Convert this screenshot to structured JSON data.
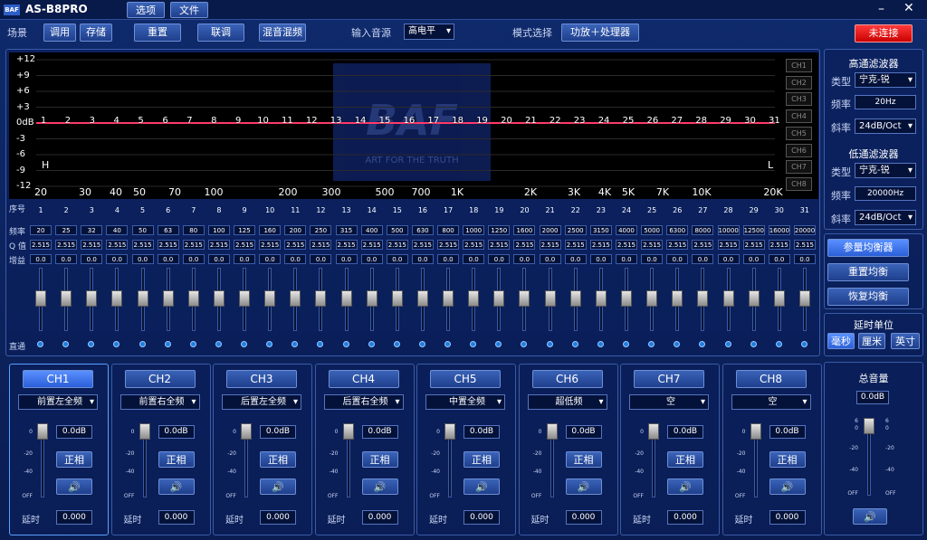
{
  "title": "AS-B8PRO",
  "menu": [
    "选项",
    "文件"
  ],
  "toolbar": {
    "scene_label": "场景",
    "call": "调用",
    "store": "存储",
    "reset": "重置",
    "link": "联调",
    "mix": "混音混频",
    "input_label": "输入音源",
    "input_value": "高电平",
    "mode_label": "模式选择",
    "mode_value": "功放＋处理器",
    "status": "未连接"
  },
  "graph": {
    "db_labels": [
      "+12",
      "+9",
      "+6",
      "+3",
      "0dB",
      "-3",
      "-6",
      "-9",
      "-12"
    ],
    "h_marker": "H",
    "l_marker": "L",
    "freq_labels": [
      "20",
      "30",
      "40",
      "50",
      "70",
      "100",
      "200",
      "300",
      "500",
      "700",
      "1K",
      "2K",
      "3K",
      "4K",
      "5K",
      "7K",
      "10K",
      "20K"
    ],
    "watermark": "BAF",
    "watermark_sub": "ART FOR THE TRUTH",
    "ch_buttons": [
      "CH1",
      "CH2",
      "CH3",
      "CH4",
      "CH5",
      "CH6",
      "CH7",
      "CH8"
    ]
  },
  "eq": {
    "row_labels": [
      "序号",
      "频率",
      "Q 值",
      "增益"
    ],
    "bypass_label": "直通",
    "freqs": [
      "20",
      "25",
      "32",
      "40",
      "50",
      "63",
      "80",
      "100",
      "125",
      "160",
      "200",
      "250",
      "315",
      "400",
      "500",
      "630",
      "800",
      "1000",
      "1250",
      "1600",
      "2000",
      "2500",
      "3150",
      "4000",
      "5000",
      "6300",
      "8000",
      "10000",
      "12500",
      "16000",
      "20000"
    ],
    "q": "2.515",
    "gain": "0.0"
  },
  "hpf": {
    "title": "高通滤波器",
    "type_label": "类型",
    "type": "宁克-锐",
    "freq_label": "频率",
    "freq": "20Hz",
    "slope_label": "斜率",
    "slope": "24dB/Oct"
  },
  "lpf": {
    "title": "低通滤波器",
    "type_label": "类型",
    "type": "宁克-锐",
    "freq_label": "频率",
    "freq": "20000Hz",
    "slope_label": "斜率",
    "slope": "24dB/Oct"
  },
  "side": {
    "peq": "参量均衡器",
    "reset_eq": "重置均衡",
    "restore_eq": "恢复均衡",
    "delay_unit": "延时单位",
    "ms": "毫秒",
    "cm": "厘米",
    "inch": "英寸"
  },
  "channels": [
    {
      "name": "CH1",
      "src": "前置左全频"
    },
    {
      "name": "CH2",
      "src": "前置右全频"
    },
    {
      "name": "CH3",
      "src": "后置左全频"
    },
    {
      "name": "CH4",
      "src": "后置右全频"
    },
    {
      "name": "CH5",
      "src": "中置全频"
    },
    {
      "name": "CH6",
      "src": "超低频"
    },
    {
      "name": "CH7",
      "src": "空"
    },
    {
      "name": "CH8",
      "src": "空"
    }
  ],
  "ch_common": {
    "gain": "0.0dB",
    "phase": "正相",
    "delay_label": "延时",
    "delay": "0.000",
    "scale": [
      "0",
      "-20",
      "-40",
      "OFF"
    ]
  },
  "master": {
    "title": "总音量",
    "value": "0.0dB",
    "scale": [
      "6",
      "0",
      "-20",
      "-40",
      "OFF"
    ]
  }
}
